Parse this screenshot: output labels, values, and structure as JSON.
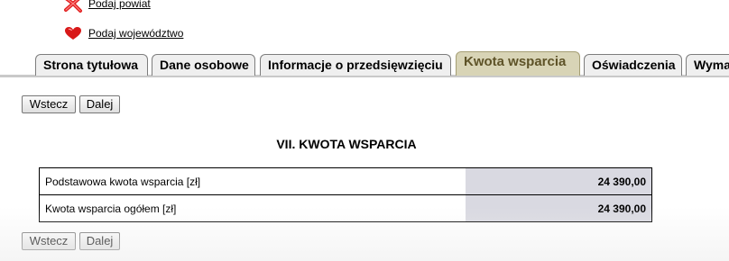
{
  "errors": [
    {
      "icon": "red-x-icon",
      "label": "Podaj powiat"
    },
    {
      "icon": "red-heart-icon",
      "label": "Podaj województwo"
    }
  ],
  "tabs": [
    {
      "label": "Strona tytułowa",
      "active": false
    },
    {
      "label": "Dane osobowe",
      "active": false
    },
    {
      "label": "Informacje o przedsięwzięciu",
      "active": false
    },
    {
      "label": "Kwota wsparcia",
      "active": true
    },
    {
      "label": "Oświadczenia",
      "active": false
    },
    {
      "label": "Wymagane załączniki",
      "active": false
    }
  ],
  "nav": {
    "back_label": "Wstecz",
    "next_label": "Dalej"
  },
  "section": {
    "title": "VII. KWOTA WSPARCIA"
  },
  "table": {
    "rows": [
      {
        "label": "Podstawowa kwota wsparcia [zł]",
        "value": "24 390,00"
      },
      {
        "label": "Kwota wsparcia ogółem [zł]",
        "value": "24 390,00"
      }
    ]
  },
  "colors": {
    "accent_tab_bg": "#d8d4b6",
    "accent_tab_text": "#5e5328",
    "value_cell_bg": "#d9d9e1",
    "error_icon": "#e02020"
  }
}
